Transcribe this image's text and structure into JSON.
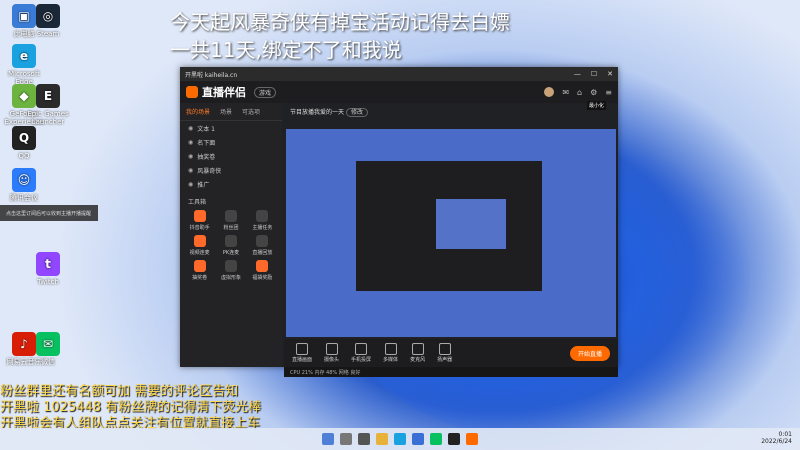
{
  "overlay": {
    "line1": "今天起风暴奇侠有掉宝活动记得去白嫖",
    "line2": "一共11天,绑定不了和我说"
  },
  "desktop_icons": [
    {
      "label": "此电脑",
      "icon": "computer-icon",
      "color": "#3a7bd5"
    },
    {
      "label": "Microsoft Edge",
      "icon": "edge-icon",
      "color": "#1aa1e0"
    },
    {
      "label": "GeForce Experience",
      "icon": "nvidia-icon",
      "color": "#6cb33f"
    },
    {
      "label": "QQ",
      "icon": "qq-icon",
      "color": "#222"
    },
    {
      "label": "网易云音乐",
      "icon": "music-icon",
      "color": "#d81e06"
    },
    {
      "label": "腾讯会议",
      "icon": "meeting-icon",
      "color": "#2b7bfb"
    },
    {
      "label": "Steam",
      "icon": "steam-icon",
      "color": "#1b2838"
    },
    {
      "label": "Epic Games Launcher",
      "icon": "epic-icon",
      "color": "#2a2a2a"
    },
    {
      "label": "Twitch",
      "icon": "twitch-icon",
      "color": "#9146ff"
    },
    {
      "label": "微信",
      "icon": "wechat-icon",
      "color": "#07c160"
    }
  ],
  "window": {
    "titlebar_text": "开黑啦  kaiheila.cn",
    "app_name": "直播伴侣",
    "pill": "游戏",
    "tabs": [
      "我的场景",
      "场景",
      "可选项"
    ],
    "layers": [
      "文本 1",
      "名下面",
      "抽奖卷",
      "风暴奇侠",
      "推广"
    ],
    "tools_header": "工具箱",
    "tools": [
      "抖音助手",
      "粉丝团",
      "主播任务",
      "视频连麦",
      "PK连麦",
      "直播回放",
      "抽奖卷",
      "虚拟形象",
      "福袋奖励"
    ],
    "stream_title": "节目放播我爱的一天",
    "stream_tag": "修改",
    "bottom": [
      "直播画面",
      "摄像头",
      "手机投屏",
      "多媒体",
      "麦克风",
      "扬声器"
    ],
    "go_live": "开始直播",
    "status_text": "CPU 21%  内存 48%  网络 良好",
    "tooltip": "最小化"
  },
  "bubble": "点击这里订阅后可以收到主播开播提醒",
  "marquee": [
    "粉丝群里还有名额可加 需要的评论区告知",
    "开黑啦 1025448  有粉丝牌的记得清下荧光棒",
    "开黑啦会有人组队点点关注有位置就直接上车"
  ],
  "tray": {
    "time": "0:01",
    "date": "2022/6/24"
  }
}
